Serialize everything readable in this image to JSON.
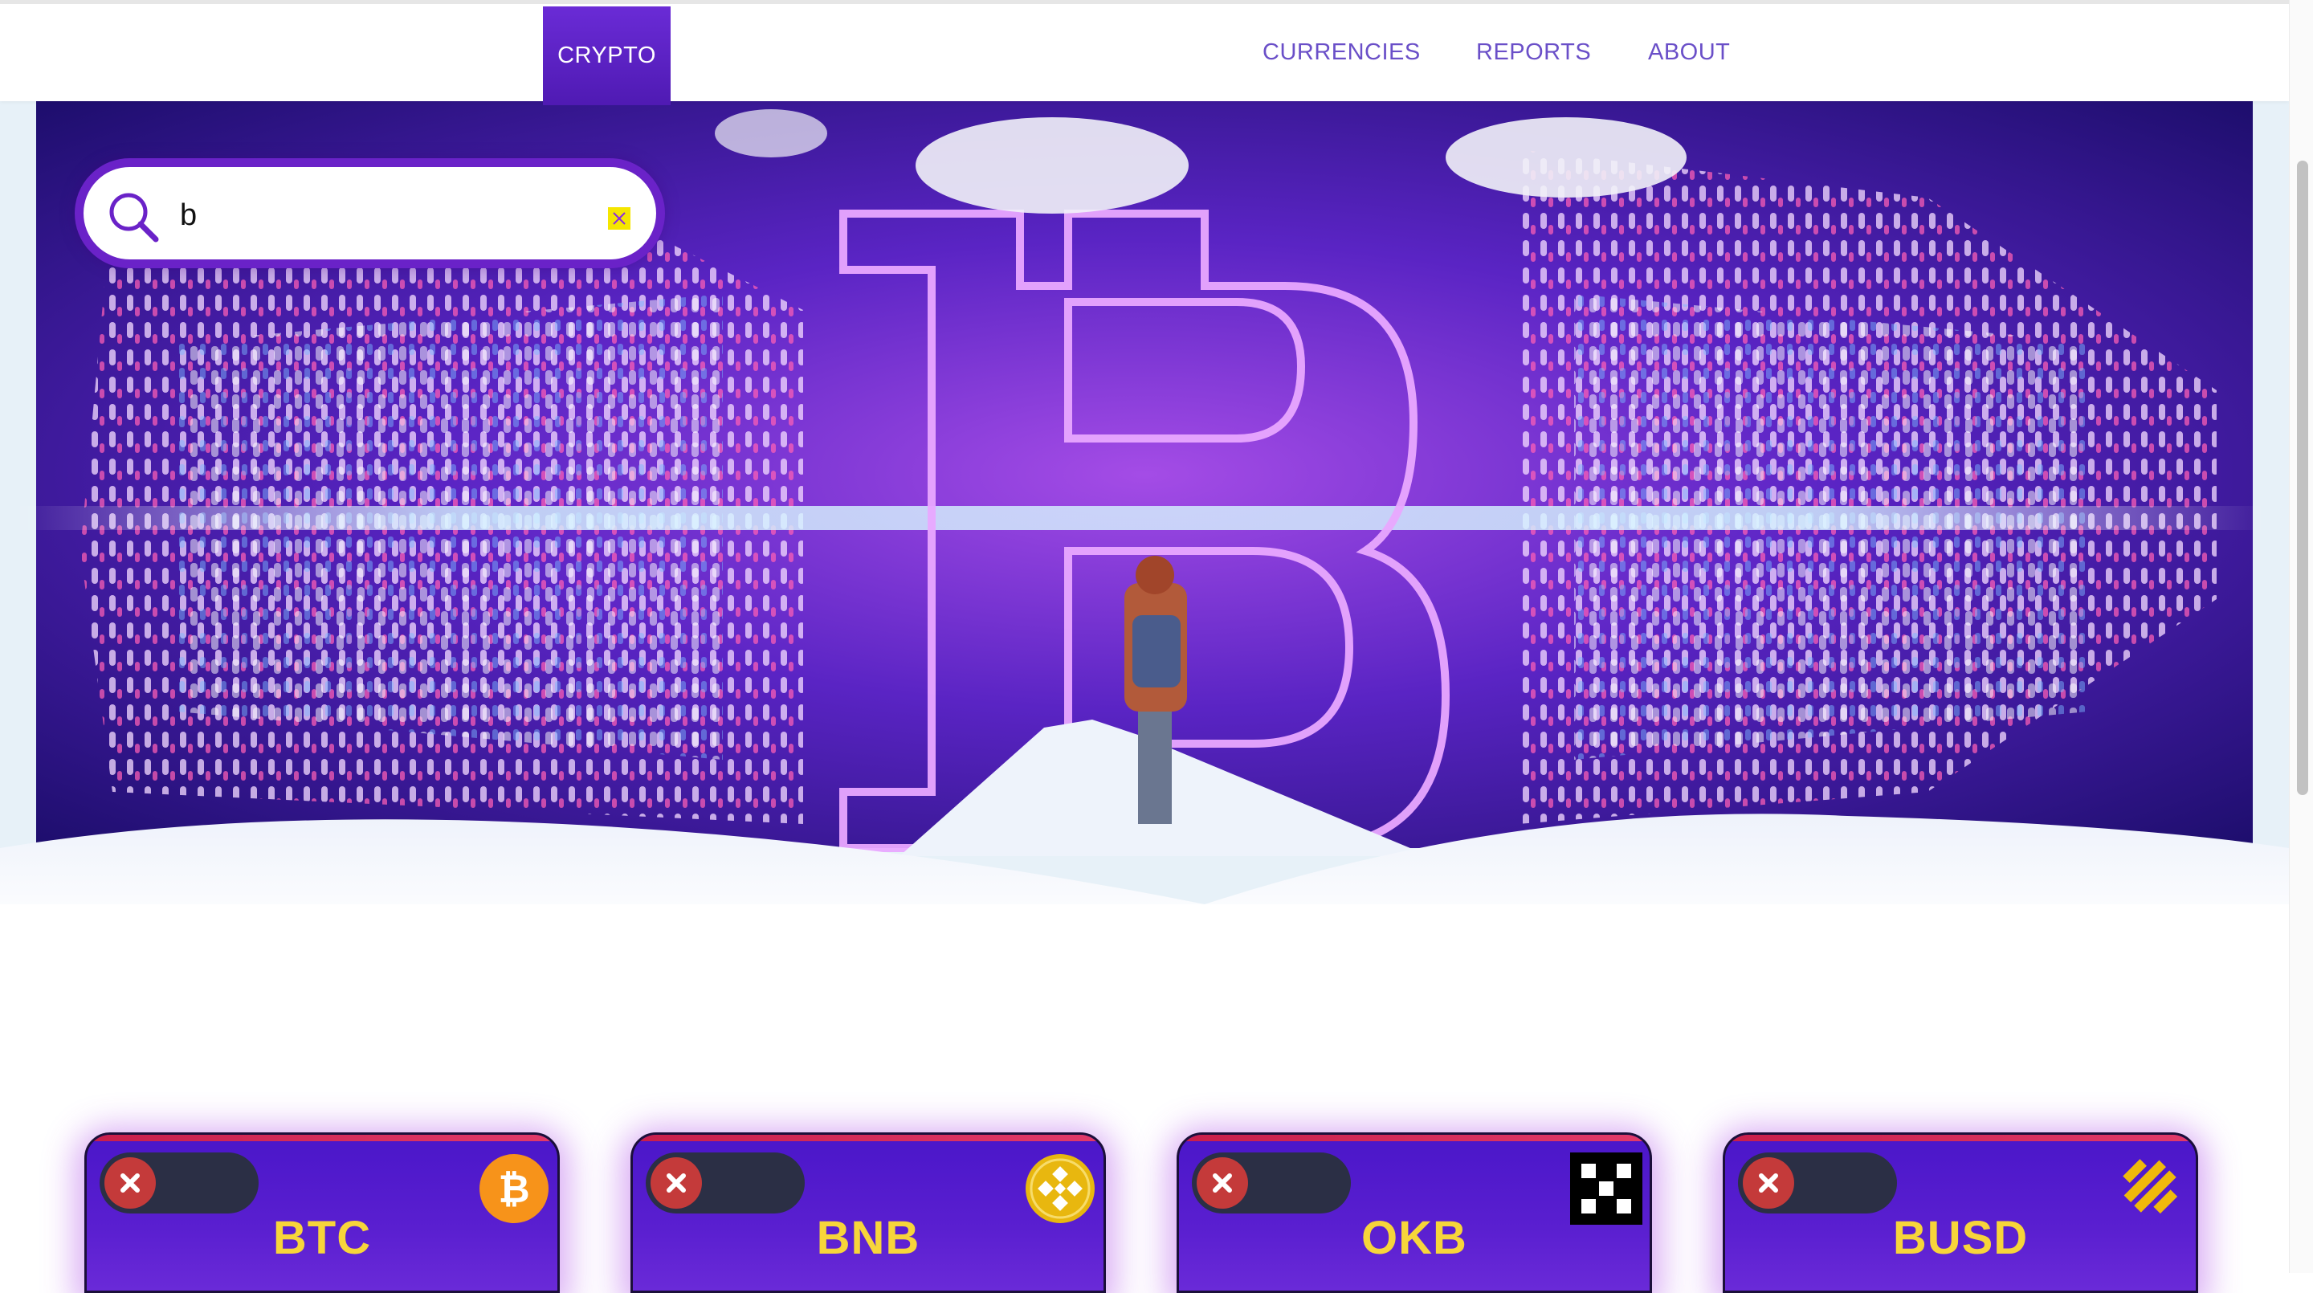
{
  "nav": {
    "brand": "CRYPTO",
    "links": [
      "CURRENCIES",
      "REPORTS",
      "ABOUT"
    ]
  },
  "search": {
    "value": "b",
    "icon": "search-icon",
    "clear_icon": "close-icon"
  },
  "hero": {
    "image": "bitcoin-hero-illustration",
    "big_letter": "B"
  },
  "cards": [
    {
      "symbol": "BTC",
      "icon": "bitcoin-icon",
      "toggle_icon": "close-icon"
    },
    {
      "symbol": "BNB",
      "icon": "binance-coin-icon",
      "toggle_icon": "close-icon"
    },
    {
      "symbol": "OKB",
      "icon": "okb-icon",
      "toggle_icon": "close-icon"
    },
    {
      "symbol": "BUSD",
      "icon": "busd-icon",
      "toggle_icon": "close-icon"
    }
  ],
  "colors": {
    "accent": "#6a22c8",
    "card_bg": "#4a16c9",
    "card_text": "#f7d53a",
    "nav_link": "#6a4fc8",
    "remove": "#c43a3a"
  }
}
